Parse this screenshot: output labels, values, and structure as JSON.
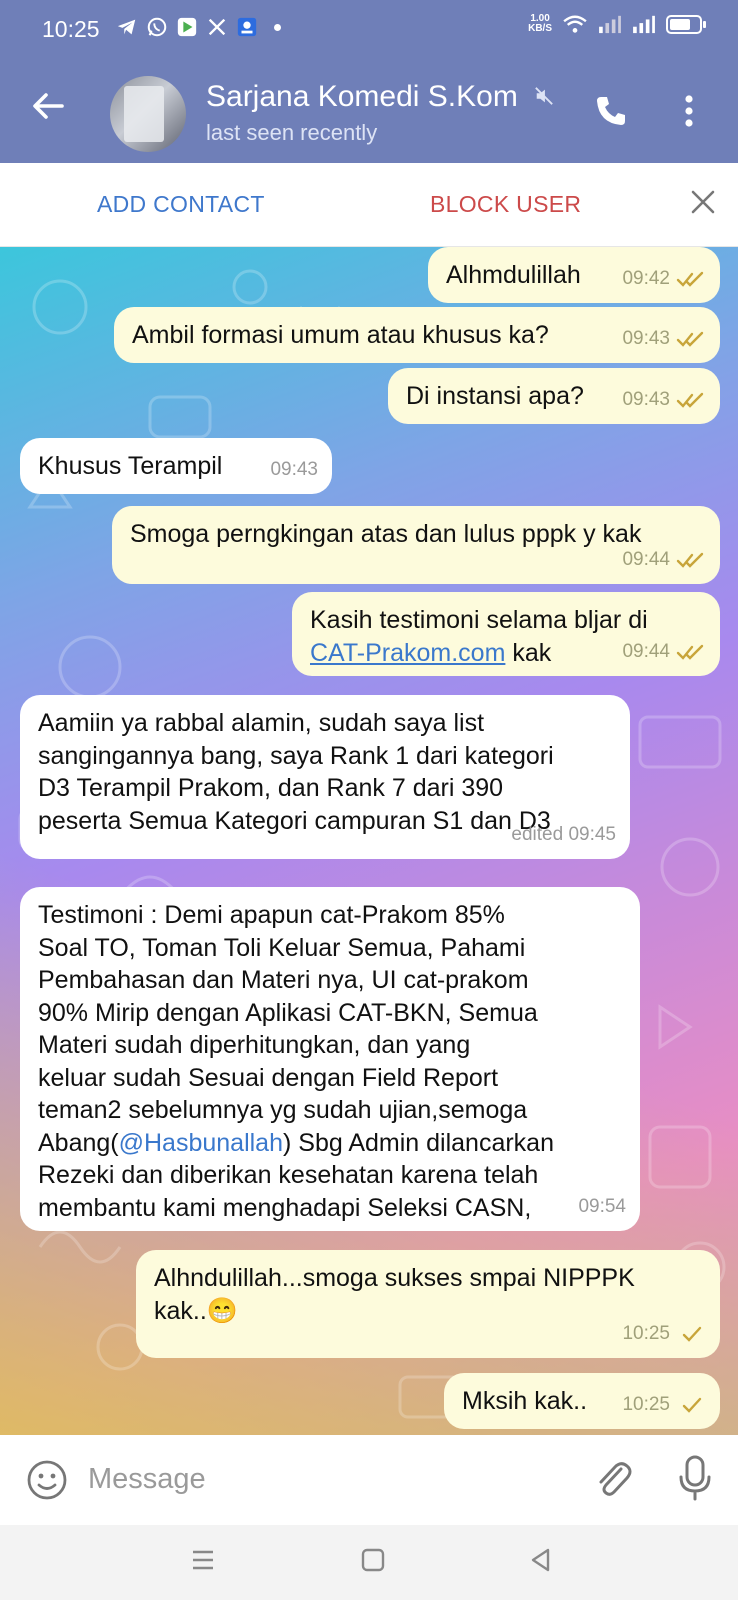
{
  "status_bar": {
    "time": "10:25",
    "net_speed_value": "1.00",
    "net_speed_unit": "KB/S",
    "icons": [
      "telegram-icon",
      "whatsapp-icon",
      "play-store-icon",
      "x-icon",
      "app-icon",
      "wifi-icon",
      "signal-icon",
      "signal-icon",
      "battery-icon"
    ]
  },
  "header": {
    "contact_name": "Sarjana Komedi S.Kom",
    "status": "last seen recently"
  },
  "action_bar": {
    "add_contact": "ADD CONTACT",
    "block_user": "BLOCK USER"
  },
  "messages": [
    {
      "dir": "out",
      "text": "Alhmdulillah",
      "time": "09:42",
      "status": "read"
    },
    {
      "dir": "out",
      "text": "Ambil formasi umum atau khusus ka?",
      "time": "09:43",
      "status": "read"
    },
    {
      "dir": "out",
      "text": "Di instansi apa?",
      "time": "09:43",
      "status": "read"
    },
    {
      "dir": "in",
      "text": "Khusus Terampil",
      "time": "09:43"
    },
    {
      "dir": "out",
      "text": "Smoga perngkingan atas dan lulus pppk y kak",
      "time": "09:44",
      "status": "read"
    },
    {
      "dir": "out",
      "text_before": "Kasih testimoni selama bljar di",
      "link": "CAT-Prakom.com",
      "text_after": " kak",
      "time": "09:44",
      "status": "read"
    },
    {
      "dir": "in",
      "lines": [
        "Aamiin ya rabbal alamin, sudah saya list",
        "sangingannya bang, saya Rank 1 dari kategori",
        "D3 Terampil Prakom, dan Rank 7 dari 390",
        "peserta Semua Kategori campuran S1 dan D3"
      ],
      "time": "edited 09:45"
    },
    {
      "dir": "in",
      "lines": [
        "Testimoni : Demi apapun cat-Prakom 85%",
        "Soal TO, Toman Toli Keluar Semua, Pahami",
        "Pembahasan dan Materi nya, UI cat-prakom",
        "90% Mirip dengan Aplikasi CAT-BKN, Semua",
        "Materi sudah diperhitungkan, dan yang",
        "keluar sudah Sesuai dengan Field Report",
        "teman2 sebelumnya yg sudah ujian,semoga"
      ],
      "mention_before": "Abang(",
      "mention": "@Hasbunallah",
      "mention_after": ") Sbg Admin dilancarkan",
      "lines_after": [
        "Rezeki dan diberikan kesehatan karena telah",
        "membantu kami menghadapi Seleksi CASN,"
      ],
      "time": "09:54"
    },
    {
      "dir": "out",
      "lines": [
        "Alhndulillah...smoga sukses smpai NIPPPK",
        "kak..😁"
      ],
      "time": "10:25",
      "status": "sent"
    },
    {
      "dir": "out",
      "text": "Mksih kak..",
      "time": "10:25",
      "status": "sent"
    }
  ],
  "input": {
    "placeholder": "Message"
  },
  "colors": {
    "header_bg": "#6f7fb8",
    "outgoing_bubble": "#fdfbdc",
    "incoming_bubble": "#ffffff",
    "link": "#3a78cc",
    "add_contact": "#3f78cc",
    "block_user": "#cc4a4a"
  },
  "nav_icons": [
    "menu-icon",
    "home-icon",
    "back-icon"
  ]
}
